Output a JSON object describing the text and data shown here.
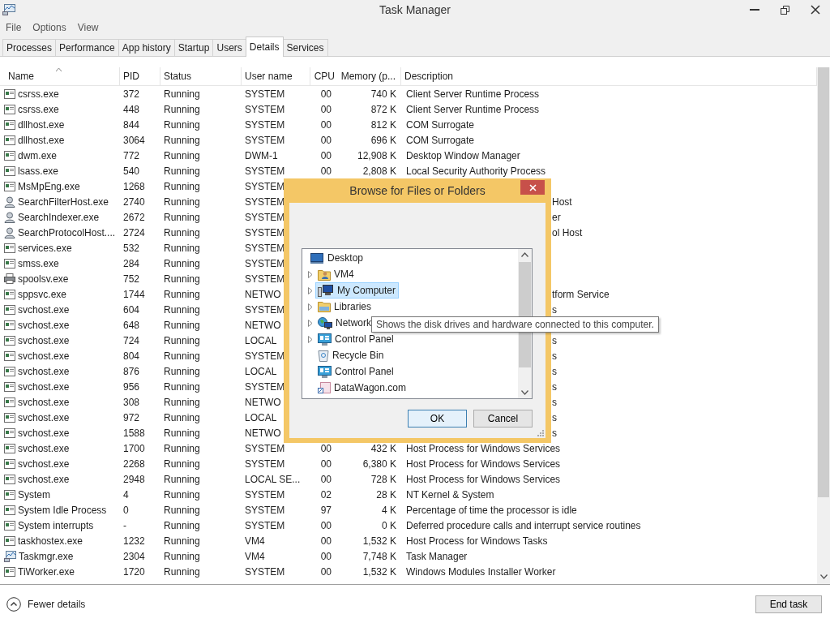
{
  "window": {
    "title": "Task Manager"
  },
  "menu": [
    "File",
    "Options",
    "View"
  ],
  "tabs": [
    {
      "label": "Processes",
      "selected": false
    },
    {
      "label": "Performance",
      "selected": false
    },
    {
      "label": "App history",
      "selected": false
    },
    {
      "label": "Startup",
      "selected": false
    },
    {
      "label": "Users",
      "selected": false
    },
    {
      "label": "Details",
      "selected": true
    },
    {
      "label": "Services",
      "selected": false
    }
  ],
  "table": {
    "columns": [
      {
        "label": "Name",
        "sorted": true
      },
      {
        "label": "PID",
        "sorted": false
      },
      {
        "label": "Status",
        "sorted": false
      },
      {
        "label": "User name",
        "sorted": false
      },
      {
        "label": "CPU",
        "sorted": false
      },
      {
        "label": "Memory (p...",
        "sorted": false
      },
      {
        "label": "Description",
        "sorted": false
      }
    ],
    "rows": [
      {
        "kind": "app",
        "name": "csrss.exe",
        "pid": "372",
        "status": "Running",
        "user": "SYSTEM",
        "cpu": "00",
        "memory": "740 K",
        "description": "Client Server Runtime Process"
      },
      {
        "kind": "app",
        "name": "csrss.exe",
        "pid": "448",
        "status": "Running",
        "user": "SYSTEM",
        "cpu": "00",
        "memory": "872 K",
        "description": "Client Server Runtime Process"
      },
      {
        "kind": "app",
        "name": "dllhost.exe",
        "pid": "844",
        "status": "Running",
        "user": "SYSTEM",
        "cpu": "00",
        "memory": "812 K",
        "description": "COM Surrogate"
      },
      {
        "kind": "app",
        "name": "dllhost.exe",
        "pid": "3064",
        "status": "Running",
        "user": "SYSTEM",
        "cpu": "00",
        "memory": "696 K",
        "description": "COM Surrogate"
      },
      {
        "kind": "app",
        "name": "dwm.exe",
        "pid": "772",
        "status": "Running",
        "user": "DWM-1",
        "cpu": "00",
        "memory": "12,908 K",
        "description": "Desktop Window Manager"
      },
      {
        "kind": "app",
        "name": "lsass.exe",
        "pid": "540",
        "status": "Running",
        "user": "SYSTEM",
        "cpu": "00",
        "memory": "2,808 K",
        "description": "Local Security Authority Process"
      },
      {
        "kind": "app",
        "name": "MsMpEng.exe",
        "pid": "1268",
        "status": "Running",
        "user": "SYSTEM"
      },
      {
        "kind": "user",
        "name": "SearchFilterHost.exe",
        "pid": "2740",
        "status": "Running",
        "user": "SYSTEM",
        "description_tail": "Host"
      },
      {
        "kind": "user",
        "name": "SearchIndexer.exe",
        "pid": "2672",
        "status": "Running",
        "user": "SYSTEM",
        "description_tail": "er"
      },
      {
        "kind": "user",
        "name": "SearchProtocolHost....",
        "pid": "2724",
        "status": "Running",
        "user": "SYSTEM",
        "description_tail": "ol Host"
      },
      {
        "kind": "app",
        "name": "services.exe",
        "pid": "532",
        "status": "Running",
        "user": "SYSTEM"
      },
      {
        "kind": "app",
        "name": "smss.exe",
        "pid": "284",
        "status": "Running",
        "user": "SYSTEM"
      },
      {
        "kind": "printer",
        "name": "spoolsv.exe",
        "pid": "752",
        "status": "Running",
        "user": "SYSTEM"
      },
      {
        "kind": "app",
        "name": "sppsvc.exe",
        "pid": "1744",
        "status": "Running",
        "user": "NETWO",
        "description_tail": "tform Service"
      },
      {
        "kind": "app",
        "name": "svchost.exe",
        "pid": "604",
        "status": "Running",
        "user": "SYSTEM",
        "description_tail": "s"
      },
      {
        "kind": "app",
        "name": "svchost.exe",
        "pid": "648",
        "status": "Running",
        "user": "NETWO"
      },
      {
        "kind": "app",
        "name": "svchost.exe",
        "pid": "724",
        "status": "Running",
        "user": "LOCAL",
        "description_tail": "s"
      },
      {
        "kind": "app",
        "name": "svchost.exe",
        "pid": "804",
        "status": "Running",
        "user": "SYSTEM",
        "description_tail": "s"
      },
      {
        "kind": "app",
        "name": "svchost.exe",
        "pid": "876",
        "status": "Running",
        "user": "LOCAL",
        "description_tail": "s"
      },
      {
        "kind": "app",
        "name": "svchost.exe",
        "pid": "956",
        "status": "Running",
        "user": "SYSTEM",
        "description_tail": "s"
      },
      {
        "kind": "app",
        "name": "svchost.exe",
        "pid": "308",
        "status": "Running",
        "user": "NETWO",
        "description_tail": "s"
      },
      {
        "kind": "app",
        "name": "svchost.exe",
        "pid": "972",
        "status": "Running",
        "user": "LOCAL",
        "description_tail": "s"
      },
      {
        "kind": "app",
        "name": "svchost.exe",
        "pid": "1588",
        "status": "Running",
        "user": "NETWO",
        "description_tail": "s"
      },
      {
        "kind": "app",
        "name": "svchost.exe",
        "pid": "1700",
        "status": "Running",
        "user": "SYSTEM",
        "cpu": "00",
        "memory": "432 K",
        "description": "Host Process for Windows Services"
      },
      {
        "kind": "app",
        "name": "svchost.exe",
        "pid": "2268",
        "status": "Running",
        "user": "SYSTEM",
        "cpu": "00",
        "memory": "6,380 K",
        "description": "Host Process for Windows Services"
      },
      {
        "kind": "app",
        "name": "svchost.exe",
        "pid": "2948",
        "status": "Running",
        "user": "LOCAL SE...",
        "cpu": "00",
        "memory": "728 K",
        "description": "Host Process for Windows Services"
      },
      {
        "kind": "app",
        "name": "System",
        "pid": "4",
        "status": "Running",
        "user": "SYSTEM",
        "cpu": "02",
        "memory": "28 K",
        "description": "NT Kernel & System"
      },
      {
        "kind": "app",
        "name": "System Idle Process",
        "pid": "0",
        "status": "Running",
        "user": "SYSTEM",
        "cpu": "97",
        "memory": "4 K",
        "description": "Percentage of time the processor is idle"
      },
      {
        "kind": "app",
        "name": "System interrupts",
        "pid": "-",
        "status": "Running",
        "user": "SYSTEM",
        "cpu": "00",
        "memory": "0 K",
        "description": "Deferred procedure calls and interrupt service routines"
      },
      {
        "kind": "app",
        "name": "taskhostex.exe",
        "pid": "1232",
        "status": "Running",
        "user": "VM4",
        "cpu": "00",
        "memory": "1,532 K",
        "description": "Host Process for Windows Tasks"
      },
      {
        "kind": "taskmgr",
        "name": "Taskmgr.exe",
        "pid": "2304",
        "status": "Running",
        "user": "VM4",
        "cpu": "00",
        "memory": "7,748 K",
        "description": "Task Manager"
      },
      {
        "kind": "app",
        "name": "TiWorker.exe",
        "pid": "1720",
        "status": "Running",
        "user": "SYSTEM",
        "cpu": "00",
        "memory": "1,532 K",
        "description": "Windows Modules Installer Worker"
      }
    ]
  },
  "footer": {
    "toggle": "Fewer details",
    "button": "End task"
  },
  "dialog": {
    "title": "Browse for Files or Folders",
    "tree": {
      "label": "Desktop",
      "kind": "desktop",
      "selected": false,
      "children": [
        {
          "label": "VM4",
          "kind": "user-folder",
          "has_children": true,
          "selected": false
        },
        {
          "label": "My Computer",
          "kind": "computer",
          "has_children": true,
          "selected": true
        },
        {
          "label": "Libraries",
          "kind": "library",
          "has_children": true,
          "selected": false
        },
        {
          "label": "Network",
          "kind": "network",
          "has_children": true,
          "selected": false
        },
        {
          "label": "Control Panel",
          "kind": "control-panel",
          "has_children": true,
          "selected": false
        },
        {
          "label": "Recycle Bin",
          "kind": "recycle-bin",
          "has_children": false,
          "selected": false
        },
        {
          "label": "Control Panel",
          "kind": "control-panel",
          "has_children": false,
          "selected": false
        },
        {
          "label": "DataWagon.com",
          "kind": "web-file",
          "has_children": false,
          "selected": false
        }
      ]
    },
    "tooltip": "Shows the disk drives and hardware connected to this computer.",
    "buttons": [
      {
        "label": "OK",
        "kind": "default"
      },
      {
        "label": "Cancel",
        "kind": "normal"
      }
    ]
  }
}
